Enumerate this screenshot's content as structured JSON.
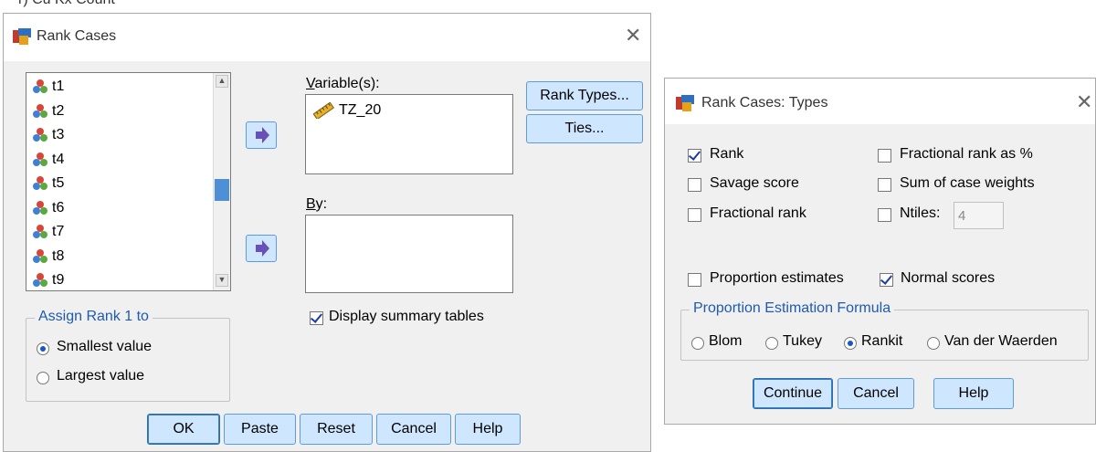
{
  "top_text": "r) Cu Kx Count",
  "rank_cases": {
    "title": "Rank Cases",
    "variables_list": [
      "t1",
      "t2",
      "t3",
      "t4",
      "t5",
      "t6",
      "t7",
      "t8",
      "t9"
    ],
    "variables_label": "Variable(s):",
    "selected_variable": "TZ_20",
    "by_label": "By:",
    "rank_types_button": "Rank Types...",
    "ties_button": "Ties...",
    "assign_group_title": "Assign Rank 1 to",
    "smallest_value": "Smallest value",
    "largest_value": "Largest value",
    "display_summary": "Display summary tables",
    "buttons": {
      "ok": "OK",
      "paste": "Paste",
      "reset": "Reset",
      "cancel": "Cancel",
      "help": "Help"
    }
  },
  "rank_types": {
    "title": "Rank Cases: Types",
    "rank": "Rank",
    "savage": "Savage score",
    "fractional": "Fractional rank",
    "fractional_pct": "Fractional rank as %",
    "sum_weights": "Sum of case weights",
    "ntiles": "Ntiles:",
    "ntiles_value": "4",
    "proportion_estimates": "Proportion estimates",
    "normal_scores": "Normal scores",
    "formula_group_title": "Proportion Estimation Formula",
    "blom": "Blom",
    "tukey": "Tukey",
    "rankit": "Rankit",
    "van_der_waerden": "Van der Waerden",
    "buttons": {
      "continue": "Continue",
      "cancel": "Cancel",
      "help": "Help"
    }
  }
}
